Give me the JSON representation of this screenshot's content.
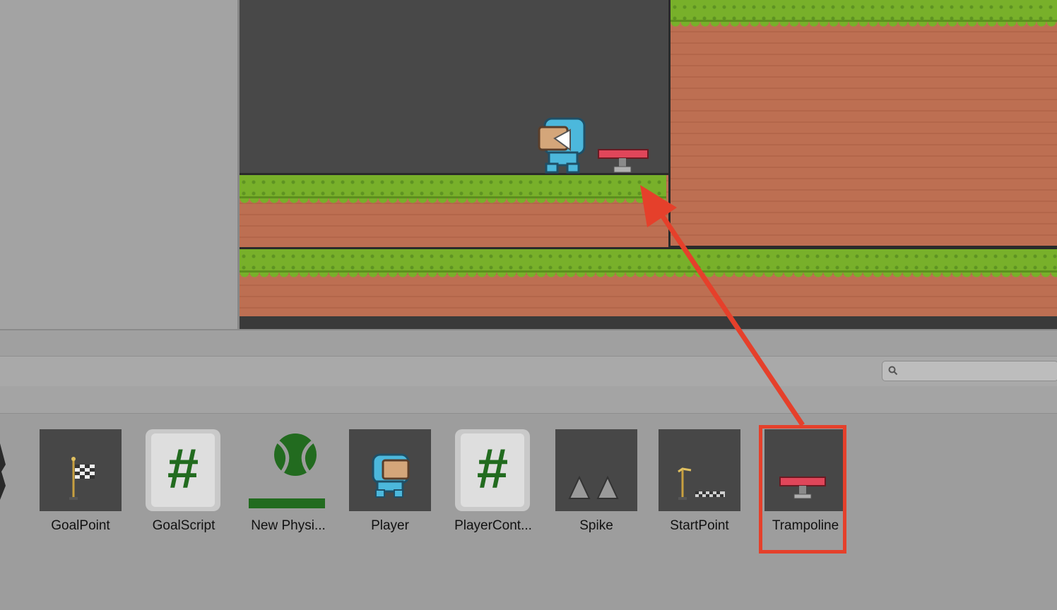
{
  "assets": [
    {
      "label": "GoalPoint",
      "icon": "flag-icon"
    },
    {
      "label": "GoalScript",
      "icon": "csharp-script-icon"
    },
    {
      "label": "New Physi...",
      "icon": "physics-material-icon"
    },
    {
      "label": "Player",
      "icon": "player-sprite-icon"
    },
    {
      "label": "PlayerCont...",
      "icon": "csharp-script-icon"
    },
    {
      "label": "Spike",
      "icon": "spike-icon"
    },
    {
      "label": "StartPoint",
      "icon": "start-point-icon"
    },
    {
      "label": "Trampoline",
      "icon": "trampoline-icon"
    }
  ],
  "search": {
    "placeholder": ""
  },
  "script_glyph": "#",
  "colors": {
    "highlight": "#e5402b",
    "grass": "#78b02a",
    "dirt": "#bd6f52",
    "scene_bg": "#484848",
    "script_hash": "#226b1f"
  }
}
